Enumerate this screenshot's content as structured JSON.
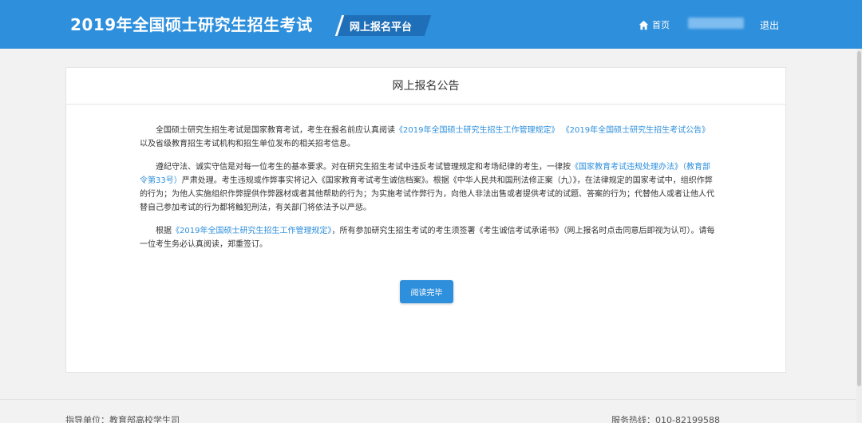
{
  "header": {
    "site_title": "2019年全国硕士研究生招生考试",
    "platform": "网上报名平台",
    "home_label": "首页",
    "logout_label": "退出",
    "background_color": "#2e8fdc"
  },
  "notice": {
    "title": "网上报名公告",
    "paragraph1": {
      "text1": "全国硕士研究生招生考试是国家教育考试，考生在报名前应认真阅读",
      "link1": "《2019年全国硕士研究生招生工作管理规定》",
      "link2": "《2019年全国硕士研究生招生考试公告》",
      "text2": "以及省级教育招生考试机构和招生单位发布的相关招考信息。"
    },
    "paragraph2": {
      "text1": "遵纪守法、诚实守信是对每一位考生的基本要求。对在研究生招生考试中违反考试管理规定和考场纪律的考生，一律按",
      "link1": "《国家教育考试违规处理办法》（教育部令第33号）",
      "text2": "严肃处理。考生违规或作弊事实将记入《国家教育考试考生诚信档案》。根据《中华人民共和国刑法修正案（九）》，在法律规定的国家考试中，组织作弊的行为；为他人实施组织作弊提供作弊器材或者其他帮助的行为；为实施考试作弊行为，向他人非法出售或者提供考试的试题、答案的行为；代替他人或者让他人代替自己参加考试的行为都将触犯刑法，有关部门将依法予以严惩。"
    },
    "paragraph3": {
      "text1": "根据",
      "link1": "《2019年全国硕士研究生招生工作管理规定》",
      "text2": "，所有参加研究生招生考试的考生须签署《考生诚信考试承诺书》（网上报名时点击同意后即视为认可）。请每一位考生务必认真阅读，郑重签订。"
    },
    "read_button": "阅读完毕",
    "link_color": "#2e8fdc"
  },
  "footer": {
    "supervisor": "指导单位：教育部高校学生司",
    "hotline": "服务热线：010-82199588"
  },
  "icons": {
    "home": "home-icon"
  }
}
